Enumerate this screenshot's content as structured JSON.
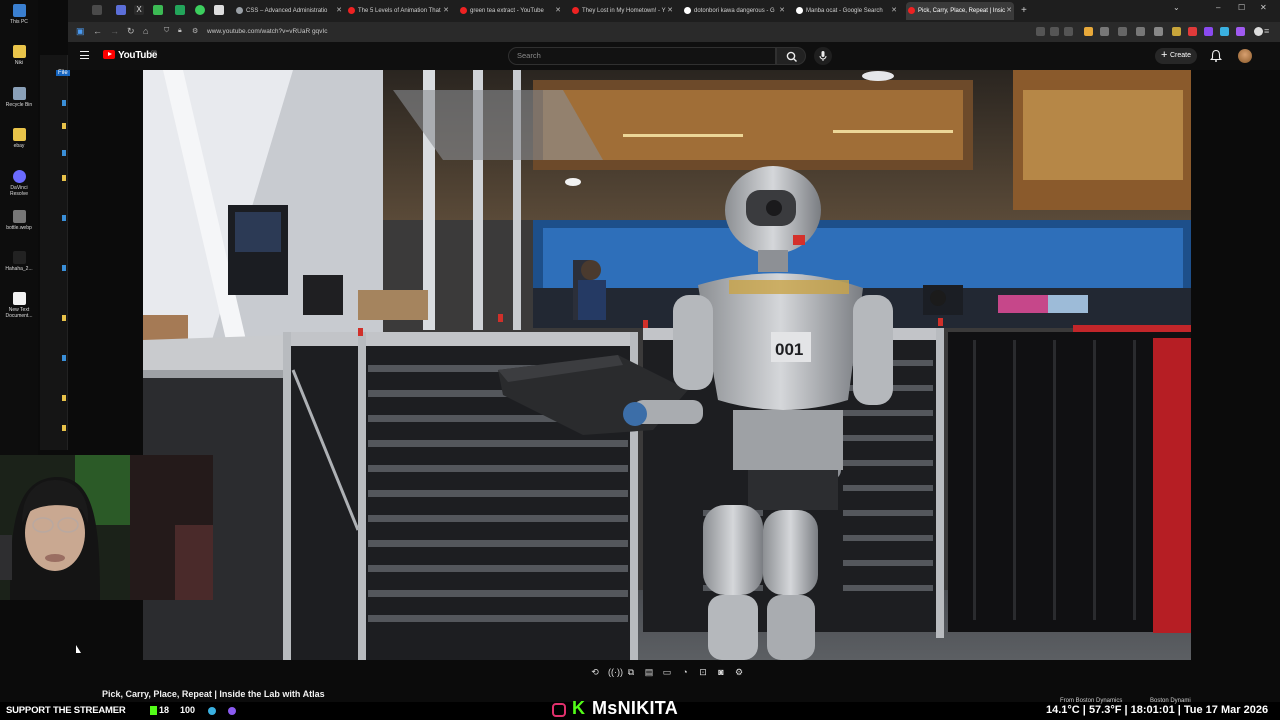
{
  "desktop": {
    "icons": [
      {
        "label": "This PC",
        "icon": "computer-icon"
      },
      {
        "label": "Niki",
        "icon": "folder-icon"
      },
      {
        "label": "Recycle Bin",
        "icon": "recycle-bin-icon"
      },
      {
        "label": "ebay",
        "icon": "folder-icon"
      },
      {
        "label": "DaVinci Resolve",
        "icon": "davinci-resolve-icon"
      },
      {
        "label": "bottle.webp",
        "icon": "image-file-icon"
      },
      {
        "label": "Hahaha_2...",
        "icon": "image-file-icon"
      },
      {
        "label": "New Text Document...",
        "icon": "text-file-icon"
      }
    ],
    "explorer_label": "File"
  },
  "browser": {
    "tabs": [
      {
        "title": "CSS – Advanced Administratio",
        "favicon": "globe-icon",
        "color": "#9aa0a6",
        "active": false
      },
      {
        "title": "The 5 Levels of Animation That",
        "favicon": "youtube-icon",
        "color": "#ff0000",
        "active": false
      },
      {
        "title": "green tea extract - YouTube",
        "favicon": "youtube-icon",
        "color": "#ff0000",
        "active": false
      },
      {
        "title": "They Lost in My Hometown! - Y",
        "favicon": "youtube-icon",
        "color": "#ff0000",
        "active": false
      },
      {
        "title": "dotonbori kawa dangerous - G",
        "favicon": "google-icon",
        "color": "#ffffff",
        "active": false
      },
      {
        "title": "Manba ocat - Google Search",
        "favicon": "google-icon",
        "color": "#ffffff",
        "active": false
      },
      {
        "title": "Pick, Carry, Place, Repeat | Insic",
        "favicon": "youtube-icon",
        "color": "#ff0000",
        "active": true
      }
    ],
    "new_tab": "+",
    "url": "www.youtube.com/watch?v=vRUaR gqvIc"
  },
  "youtube": {
    "logo_text": "YouTube",
    "logo_super": "GB",
    "search_placeholder": "Search",
    "create_label": "Create"
  },
  "video": {
    "title": "Pick, Carry, Place, Repeat | Inside the Lab with Atlas",
    "robot_number": "001"
  },
  "overlay": {
    "support_text": "SUPPORT THE STREAMER",
    "kick_count": "18",
    "viewer_count": "100",
    "brand_k": "K",
    "brand_name": "MsNIKITA",
    "channel_left": "From Boston Dynamics",
    "channel_right": "Boston Dynami",
    "weather": "14.1°C | 57.3°F | 18:01:01 | Tue 17 Mar 2026"
  },
  "colors": {
    "accent_red": "#ff0000",
    "kick_green": "#53fc18",
    "bg": "#0f0f0f"
  }
}
